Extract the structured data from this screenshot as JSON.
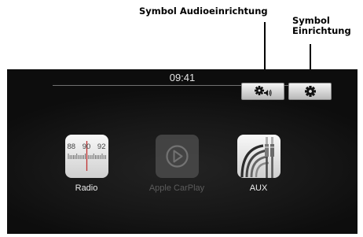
{
  "annotations": {
    "audio_symbol": "Symbol Audioeinrichtung",
    "settings_symbol_line1": "Symbol",
    "settings_symbol_line2": "Einrichtung"
  },
  "screen": {
    "time": "09:41",
    "header_buttons": [
      {
        "icon": "audio-settings-icon"
      },
      {
        "icon": "gear-icon"
      }
    ],
    "apps": [
      {
        "label": "Radio",
        "icon": "radio-dial-icon",
        "enabled": true,
        "dial_frequencies": [
          "88",
          "90",
          "92"
        ]
      },
      {
        "label": "Apple CarPlay",
        "icon": "carplay-icon",
        "enabled": false
      },
      {
        "label": "AUX",
        "icon": "aux-cable-icon",
        "enabled": true
      }
    ]
  },
  "colors": {
    "screen_bg": "#151515",
    "active_label": "#ececec",
    "disabled_label": "#5c5c5c"
  }
}
